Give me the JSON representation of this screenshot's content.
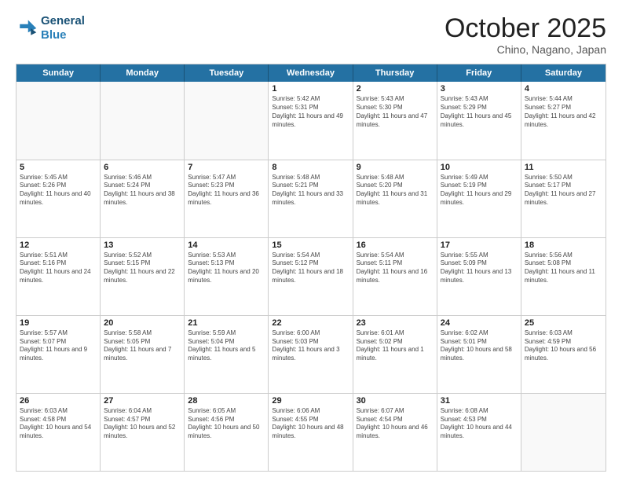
{
  "header": {
    "logo_line1": "General",
    "logo_line2": "Blue",
    "month": "October 2025",
    "location": "Chino, Nagano, Japan"
  },
  "days_of_week": [
    "Sunday",
    "Monday",
    "Tuesday",
    "Wednesday",
    "Thursday",
    "Friday",
    "Saturday"
  ],
  "rows": [
    [
      {
        "day": "",
        "text": ""
      },
      {
        "day": "",
        "text": ""
      },
      {
        "day": "",
        "text": ""
      },
      {
        "day": "1",
        "text": "Sunrise: 5:42 AM\nSunset: 5:31 PM\nDaylight: 11 hours and 49 minutes."
      },
      {
        "day": "2",
        "text": "Sunrise: 5:43 AM\nSunset: 5:30 PM\nDaylight: 11 hours and 47 minutes."
      },
      {
        "day": "3",
        "text": "Sunrise: 5:43 AM\nSunset: 5:29 PM\nDaylight: 11 hours and 45 minutes."
      },
      {
        "day": "4",
        "text": "Sunrise: 5:44 AM\nSunset: 5:27 PM\nDaylight: 11 hours and 42 minutes."
      }
    ],
    [
      {
        "day": "5",
        "text": "Sunrise: 5:45 AM\nSunset: 5:26 PM\nDaylight: 11 hours and 40 minutes."
      },
      {
        "day": "6",
        "text": "Sunrise: 5:46 AM\nSunset: 5:24 PM\nDaylight: 11 hours and 38 minutes."
      },
      {
        "day": "7",
        "text": "Sunrise: 5:47 AM\nSunset: 5:23 PM\nDaylight: 11 hours and 36 minutes."
      },
      {
        "day": "8",
        "text": "Sunrise: 5:48 AM\nSunset: 5:21 PM\nDaylight: 11 hours and 33 minutes."
      },
      {
        "day": "9",
        "text": "Sunrise: 5:48 AM\nSunset: 5:20 PM\nDaylight: 11 hours and 31 minutes."
      },
      {
        "day": "10",
        "text": "Sunrise: 5:49 AM\nSunset: 5:19 PM\nDaylight: 11 hours and 29 minutes."
      },
      {
        "day": "11",
        "text": "Sunrise: 5:50 AM\nSunset: 5:17 PM\nDaylight: 11 hours and 27 minutes."
      }
    ],
    [
      {
        "day": "12",
        "text": "Sunrise: 5:51 AM\nSunset: 5:16 PM\nDaylight: 11 hours and 24 minutes."
      },
      {
        "day": "13",
        "text": "Sunrise: 5:52 AM\nSunset: 5:15 PM\nDaylight: 11 hours and 22 minutes."
      },
      {
        "day": "14",
        "text": "Sunrise: 5:53 AM\nSunset: 5:13 PM\nDaylight: 11 hours and 20 minutes."
      },
      {
        "day": "15",
        "text": "Sunrise: 5:54 AM\nSunset: 5:12 PM\nDaylight: 11 hours and 18 minutes."
      },
      {
        "day": "16",
        "text": "Sunrise: 5:54 AM\nSunset: 5:11 PM\nDaylight: 11 hours and 16 minutes."
      },
      {
        "day": "17",
        "text": "Sunrise: 5:55 AM\nSunset: 5:09 PM\nDaylight: 11 hours and 13 minutes."
      },
      {
        "day": "18",
        "text": "Sunrise: 5:56 AM\nSunset: 5:08 PM\nDaylight: 11 hours and 11 minutes."
      }
    ],
    [
      {
        "day": "19",
        "text": "Sunrise: 5:57 AM\nSunset: 5:07 PM\nDaylight: 11 hours and 9 minutes."
      },
      {
        "day": "20",
        "text": "Sunrise: 5:58 AM\nSunset: 5:05 PM\nDaylight: 11 hours and 7 minutes."
      },
      {
        "day": "21",
        "text": "Sunrise: 5:59 AM\nSunset: 5:04 PM\nDaylight: 11 hours and 5 minutes."
      },
      {
        "day": "22",
        "text": "Sunrise: 6:00 AM\nSunset: 5:03 PM\nDaylight: 11 hours and 3 minutes."
      },
      {
        "day": "23",
        "text": "Sunrise: 6:01 AM\nSunset: 5:02 PM\nDaylight: 11 hours and 1 minute."
      },
      {
        "day": "24",
        "text": "Sunrise: 6:02 AM\nSunset: 5:01 PM\nDaylight: 10 hours and 58 minutes."
      },
      {
        "day": "25",
        "text": "Sunrise: 6:03 AM\nSunset: 4:59 PM\nDaylight: 10 hours and 56 minutes."
      }
    ],
    [
      {
        "day": "26",
        "text": "Sunrise: 6:03 AM\nSunset: 4:58 PM\nDaylight: 10 hours and 54 minutes."
      },
      {
        "day": "27",
        "text": "Sunrise: 6:04 AM\nSunset: 4:57 PM\nDaylight: 10 hours and 52 minutes."
      },
      {
        "day": "28",
        "text": "Sunrise: 6:05 AM\nSunset: 4:56 PM\nDaylight: 10 hours and 50 minutes."
      },
      {
        "day": "29",
        "text": "Sunrise: 6:06 AM\nSunset: 4:55 PM\nDaylight: 10 hours and 48 minutes."
      },
      {
        "day": "30",
        "text": "Sunrise: 6:07 AM\nSunset: 4:54 PM\nDaylight: 10 hours and 46 minutes."
      },
      {
        "day": "31",
        "text": "Sunrise: 6:08 AM\nSunset: 4:53 PM\nDaylight: 10 hours and 44 minutes."
      },
      {
        "day": "",
        "text": ""
      }
    ]
  ]
}
